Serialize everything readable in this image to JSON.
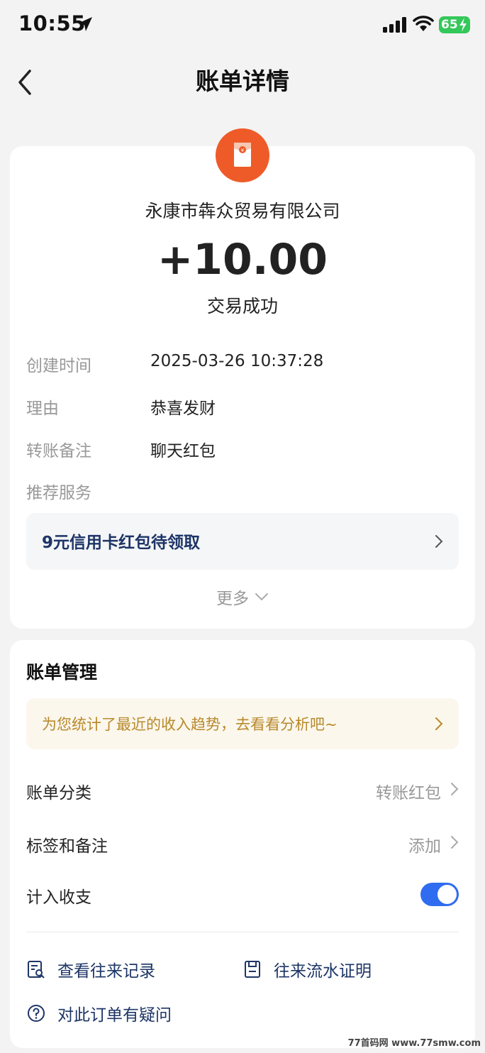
{
  "status_bar": {
    "time": "10:55",
    "battery": "65"
  },
  "nav": {
    "title": "账单详情"
  },
  "bill": {
    "merchant": "永康市犇众贸易有限公司",
    "amount": "+10.00",
    "status": "交易成功",
    "rows": [
      {
        "label": "创建时间",
        "value": "2025-03-26 10:37:28"
      },
      {
        "label": "理由",
        "value": "恭喜发财"
      },
      {
        "label": "转账备注",
        "value": "聊天红包"
      },
      {
        "label": "推荐服务",
        "value": ""
      }
    ],
    "promo": "9元信用卡红包待领取",
    "more": "更多"
  },
  "management": {
    "title": "账单管理",
    "tip": "为您统计了最近的收入趋势，去看看分析吧~",
    "category_label": "账单分类",
    "category_value": "转账红包",
    "tags_label": "标签和备注",
    "tags_value": "添加",
    "count_label": "计入收支",
    "count_enabled": true,
    "links": {
      "records": "查看往来记录",
      "proof": "往来流水证明",
      "question": "对此订单有疑问"
    }
  },
  "watermark": "77首码网 www.77smw.com",
  "colors": {
    "accent": "#2f6cf0",
    "avatar": "#ef5b28",
    "tip_text": "#b8892c",
    "link": "#1d3566"
  }
}
